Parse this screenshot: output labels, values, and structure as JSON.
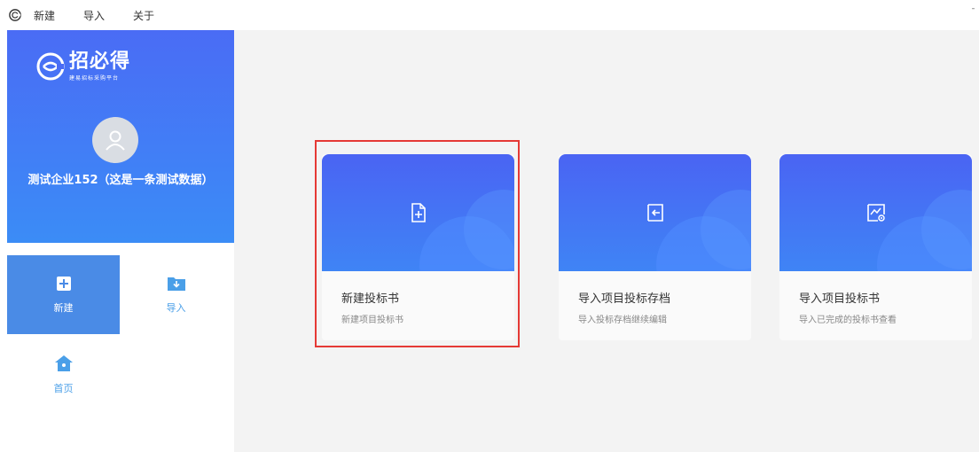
{
  "menubar": {
    "items": [
      "新建",
      "导入",
      "关于"
    ]
  },
  "sidebar": {
    "logo": {
      "name": "招必得",
      "subtitle": "建易招标采购平台"
    },
    "company_name": "测试企业152（这是一条测试数据）",
    "nav": [
      {
        "label": "新建",
        "icon": "plus-icon",
        "active": true
      },
      {
        "label": "导入",
        "icon": "folder-download-icon",
        "active": false
      },
      {
        "label": "首页",
        "icon": "home-icon",
        "active": false
      }
    ]
  },
  "cards": [
    {
      "title": "新建投标书",
      "subtitle": "新建项目投标书",
      "icon": "new-file-icon",
      "highlighted": true
    },
    {
      "title": "导入项目投标存档",
      "subtitle": "导入投标存档继续编辑",
      "icon": "import-arrow-icon",
      "highlighted": false
    },
    {
      "title": "导入项目投标书",
      "subtitle": "导入已完成的投标书查看",
      "icon": "image-view-icon",
      "highlighted": false
    }
  ],
  "colors": {
    "accent": "#4a6cf5",
    "nav_active": "#4a8be6",
    "nav_icon": "#4a9fe8",
    "highlight": "#e53935"
  }
}
